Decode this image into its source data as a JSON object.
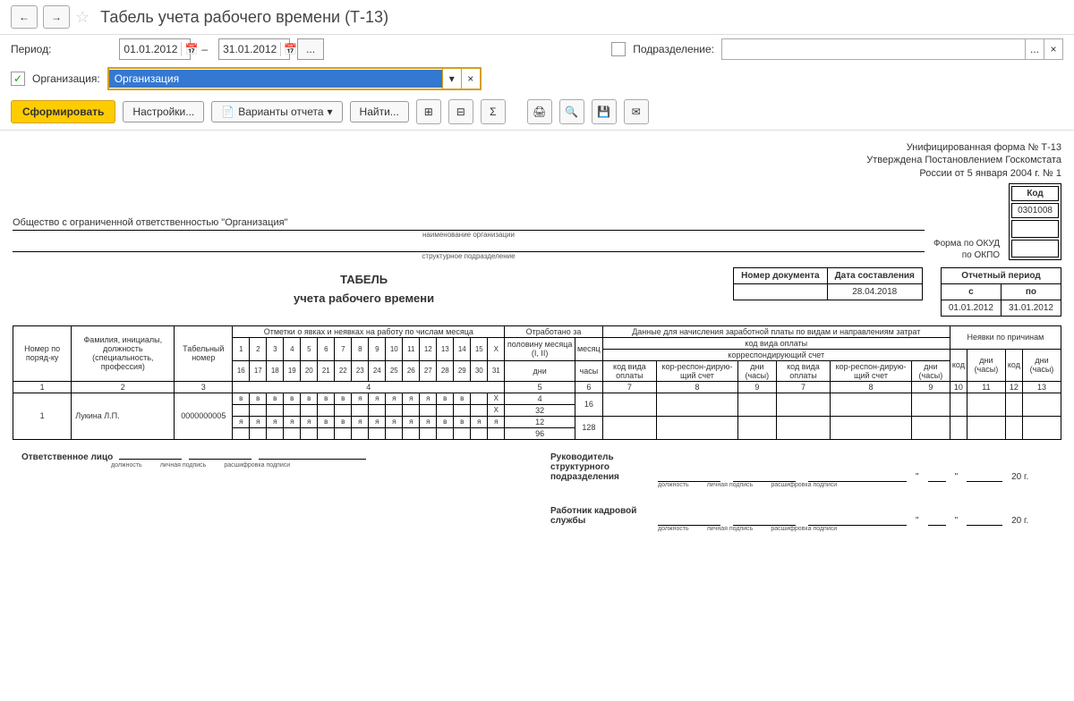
{
  "nav": {
    "back": "←",
    "fwd": "→"
  },
  "title": "Табель учета рабочего времени (Т-13)",
  "period": {
    "label": "Период:",
    "from": "01.01.2012",
    "to": "31.01.2012"
  },
  "dept": {
    "label": "Подразделение:"
  },
  "org": {
    "label": "Организация:",
    "value": "Организация"
  },
  "toolbar": {
    "generate": "Сформировать",
    "settings": "Настройки...",
    "variants": "Варианты отчета",
    "find": "Найти..."
  },
  "report": {
    "form_line1": "Унифицированная форма № Т-13",
    "form_line2": "Утверждена Постановлением Госкомстата",
    "form_line3": "России от 5 января 2004 г. № 1",
    "code_label": "Код",
    "okud_label": "Форма по ОКУД",
    "okud_code": "0301008",
    "okpo_label": "по ОКПО",
    "org_full": "Общество с ограниченной ответственностью \"Организация\"",
    "org_caption": "наименование организации",
    "subdiv_caption": "структурное подразделение",
    "title1": "ТАБЕЛЬ",
    "title2": "учета  рабочего времени",
    "doc_num_label": "Номер документа",
    "doc_date_label": "Дата составления",
    "doc_date": "28.04.2018",
    "period_label": "Отчетный период",
    "period_from_label": "с",
    "period_to_label": "по",
    "period_from": "01.01.2012",
    "period_to": "31.01.2012"
  },
  "headers": {
    "col1": "Номер по поряд-ку",
    "col2": "Фамилия, инициалы, должность (специальность, профессия)",
    "col3": "Табельный номер",
    "marks": "Отметки о явках и неявках на работу по числам месяца",
    "col5": "Отработано за",
    "col5a": "половину месяца (I, II)",
    "col5b": "месяц",
    "dni": "дни",
    "chasy": "часы",
    "salary": "Данные для начисления заработной платы по видам и направлениям затрат",
    "pay_code": "код вида оплаты",
    "corr": "корреспондирующий счет",
    "cod_vida": "код вида оплаты",
    "corr_sch": "кор-респон-дирую-щий счет",
    "dni_chasy": "дни (часы)",
    "absence": "Неявки по причинам",
    "abs_code": "код",
    "x_label": "X"
  },
  "colnums": {
    "c1": "1",
    "c2": "2",
    "c3": "3",
    "c4": "4",
    "c5": "5",
    "c6": "6",
    "c7": "7",
    "c8": "8",
    "c9": "9",
    "c10": "10",
    "c11": "11",
    "c12": "12",
    "c13": "13"
  },
  "row": {
    "num": "1",
    "name": "Лукина   Л.П.",
    "tab_num": "0000000005",
    "r1": [
      "в",
      "в",
      "в",
      "в",
      "в",
      "в",
      "в",
      "я",
      "я",
      "я",
      "я",
      "я",
      "в",
      "в",
      "X"
    ],
    "r3": [
      "я",
      "я",
      "я",
      "я",
      "я",
      "в",
      "в",
      "я",
      "я",
      "я",
      "я",
      "я",
      "в",
      "в",
      "я",
      "я"
    ],
    "half1_days": "4",
    "half1_hours": "32",
    "half2_days": "12",
    "half2_hours": "96",
    "month_days": "16",
    "month_hours": "128",
    "x": "X"
  },
  "sig": {
    "resp": "Ответственное лицо",
    "head": "Руководитель структурного подразделения",
    "hr": "Работник кадровой службы",
    "post": "должность",
    "sign": "личная подпись",
    "decode": "расшифровка подписи",
    "year_suffix": "20    г.",
    "quote": "\""
  },
  "days_top": [
    "1",
    "2",
    "3",
    "4",
    "5",
    "6",
    "7",
    "8",
    "9",
    "10",
    "11",
    "12",
    "13",
    "14",
    "15",
    "X"
  ],
  "days_bot": [
    "16",
    "17",
    "18",
    "19",
    "20",
    "21",
    "22",
    "23",
    "24",
    "25",
    "26",
    "27",
    "28",
    "29",
    "30",
    "31"
  ]
}
